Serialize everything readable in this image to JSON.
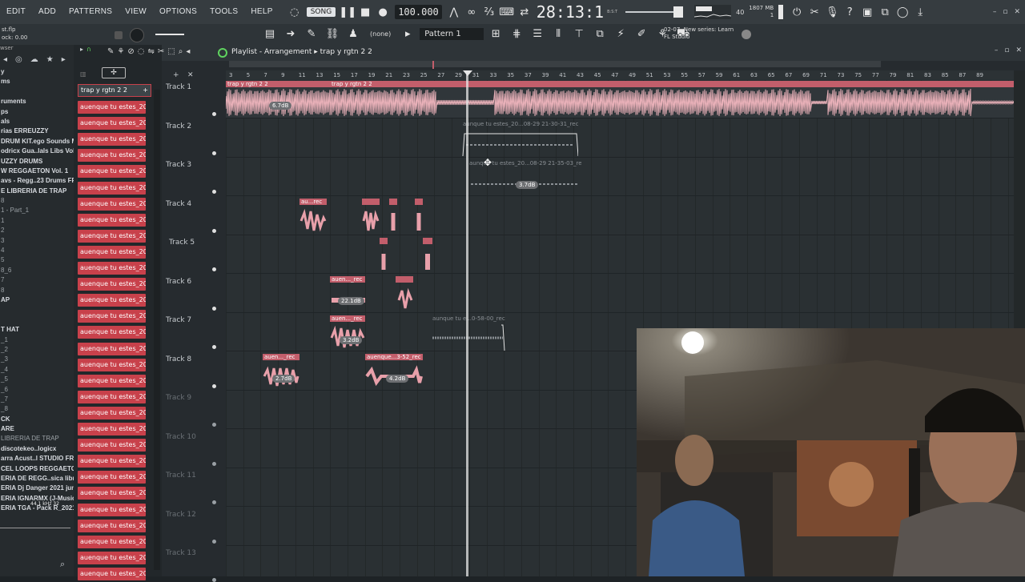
{
  "menu": [
    "EDIT",
    "ADD",
    "PATTERNS",
    "VIEW",
    "OPTIONS",
    "TOOLS",
    "HELP"
  ],
  "transport": {
    "song_label": "SONG",
    "tempo": "100.000",
    "time": "28:13:1",
    "time_sub": "B:S:T",
    "cpu_val": "40",
    "mem": "1807 MB",
    "mem_sub": "1"
  },
  "project": {
    "file": "st.flp",
    "clock": "ock: 0.00"
  },
  "toolbar2": {
    "snap": "(none)",
    "pattern": "Pattern 1",
    "news_date": "02-07",
    "news_title": "New series: Learn",
    "news_sub": "FL Studio"
  },
  "playlist": {
    "title": "Playlist - Arrangement",
    "arrangement": "trap y rgtn 2 2",
    "pattern_selector": "trap y rgtn 2 2",
    "ruler": [
      "3",
      "5",
      "7",
      "9",
      "11",
      "13",
      "15",
      "17",
      "19",
      "21",
      "23",
      "25",
      "27",
      "29",
      "31",
      "33",
      "35",
      "37",
      "39",
      "41",
      "43",
      "45",
      "47",
      "49",
      "51",
      "53",
      "55",
      "57",
      "59",
      "61",
      "63",
      "65",
      "67",
      "69",
      "71",
      "73",
      "75",
      "77",
      "79",
      "81",
      "83",
      "85",
      "87",
      "89"
    ],
    "tracks": [
      "Track 1",
      "Track 2",
      "Track 3",
      "Track 4",
      "Track 5",
      "Track 6",
      "Track 7",
      "Track 8",
      "Track 9",
      "Track 10",
      "Track 11",
      "Track 12",
      "Track 13"
    ],
    "clip_labels": {
      "t1a": "trap y rgtn 2 2",
      "t1b": "trap y rgtn 2 2",
      "t2": "aunque tu estes_20...08-29 21-30-31_rec",
      "t3": "aunque tu estes_20...08-29 21-35-03_rec",
      "t4a": "au...rec",
      "t6a": "auen..._rec",
      "t7a": "auen..._rec",
      "t7b": "aunque tu e...0-58-00_rec",
      "t8a": "auen..._rec",
      "t8b": "auenque...3-52_rec"
    },
    "gains": {
      "t1": "6.7dB",
      "t3": "3.7dB",
      "t6": "22.1dB",
      "t7": "3.2dB",
      "t8a": "2.7dB",
      "t8b": "4.2dB"
    }
  },
  "rack_items": [
    "auenque tu estes_2025-",
    "auenque tu estes_2025-",
    "auenque tu estes_2025-",
    "auenque tu estes_2025-",
    "auenque tu estes_2025-",
    "auenque tu estes_2025-",
    "auenque tu estes_2025-",
    "auenque tu estes_2025-",
    "auenque tu estes_2025-",
    "auenque tu estes_2025-",
    "auenque tu estes_2025-",
    "auenque tu estes_2025-",
    "auenque tu estes_2025-",
    "auenque tu estes_2025-",
    "auenque tu estes_2025-",
    "auenque tu estes_2025-",
    "auenque tu estes_2025-",
    "auenque tu estes_2025-",
    "auenque tu estes_2025-",
    "auenque tu estes_2025-",
    "auenque tu estes_2025-",
    "auenque tu estes_2025-",
    "auenque tu estes_2025-",
    "auenque tu estes_2025-",
    "auenque tu estes_2025-",
    "auenque tu estes_2025-",
    "auenque tu estes_2025-",
    "auenque tu estes_2025-",
    "auenque tu estes_2025-",
    "auenque tu estes_2025-"
  ],
  "browser": {
    "title": "wser",
    "items": [
      {
        "t": "y",
        "b": true
      },
      {
        "t": "ms",
        "b": true
      },
      {
        "t": "",
        "b": false
      },
      {
        "t": "ruments",
        "b": true
      },
      {
        "t": "ps",
        "b": true
      },
      {
        "t": "als",
        "b": true
      },
      {
        "t": "rias ERREUZZY",
        "b": true
      },
      {
        "t": "DRUM KIT.ego Sounds Mx",
        "b": true
      },
      {
        "t": "odricx Gua..lals Libs Vol.1",
        "b": true
      },
      {
        "t": "UZZY DRUMS",
        "b": true
      },
      {
        "t": "W REGGAETON Vol. 1",
        "b": true
      },
      {
        "t": "avs - Regg..23 Drums FREE",
        "b": true
      },
      {
        "t": "E LIBRERIA DE TRAP",
        "b": true
      },
      {
        "t": "8",
        "b": false
      },
      {
        "t": "1 - Part_1",
        "b": false
      },
      {
        "t": "1",
        "b": false
      },
      {
        "t": "2",
        "b": false
      },
      {
        "t": "3",
        "b": false
      },
      {
        "t": "4",
        "b": false
      },
      {
        "t": "5",
        "b": false
      },
      {
        "t": "8_6",
        "b": false
      },
      {
        "t": "7",
        "b": false
      },
      {
        "t": "8",
        "b": false
      },
      {
        "t": "AP",
        "b": true
      },
      {
        "t": "",
        "b": false
      },
      {
        "t": "",
        "b": false
      },
      {
        "t": "T HAT",
        "b": true
      },
      {
        "t": "_1",
        "b": false
      },
      {
        "t": "_2",
        "b": false
      },
      {
        "t": "_3",
        "b": false
      },
      {
        "t": "_4",
        "b": false
      },
      {
        "t": "_5",
        "b": false
      },
      {
        "t": "_6",
        "b": false
      },
      {
        "t": "_7",
        "b": false
      },
      {
        "t": "_8",
        "b": false
      },
      {
        "t": "CK",
        "b": true
      },
      {
        "t": "ARE",
        "b": true
      },
      {
        "t": "LIBRERIA DE TRAP",
        "b": false
      },
      {
        "t": "discotekeo..logicx",
        "b": true
      },
      {
        "t": "arra Acust..l STUDIO FREE",
        "b": true
      },
      {
        "t": "CEL LOOPS REGGAETON",
        "b": true
      },
      {
        "t": "ERIA DE REGG..sica libre )",
        "b": true
      },
      {
        "t": "ERIA Dj Danger 2021 junio",
        "b": true
      },
      {
        "t": "ERIA IGNARMX (J-Music)",
        "b": true
      },
      {
        "t": "ERIA TGA - Pack R_2021",
        "b": true
      }
    ],
    "sample_rate": "44.1 kHz 32"
  },
  "colors": {
    "clip": "#c25e6b",
    "rack": "#c8414b",
    "accent": "#5fd35f"
  }
}
